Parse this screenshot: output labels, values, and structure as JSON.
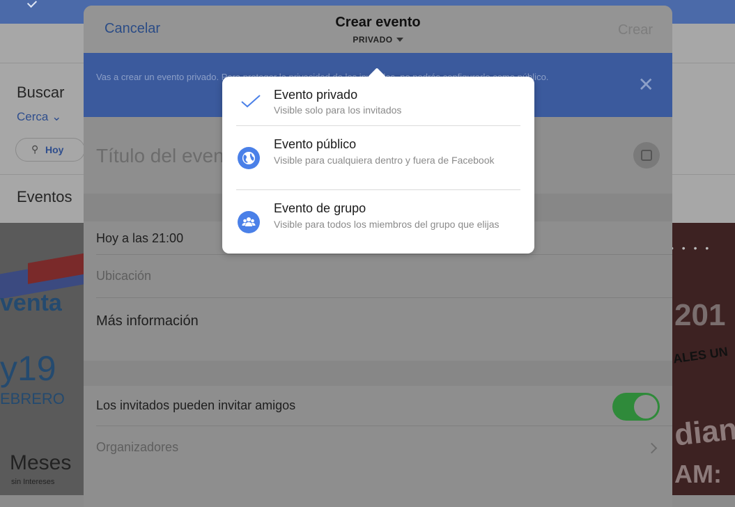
{
  "background": {
    "search_label": "Buscar",
    "nearby_label": "Cerca",
    "today_chip": "Hoy",
    "events_heading": "Eventos",
    "left_poster": {
      "word": "venta",
      "number": "y19",
      "month": "EBRERO",
      "promo": "Meses",
      "promo_sub": "sin Intereses"
    },
    "right_poster": {
      "year": "201",
      "line": "ALES UN",
      "word": "dian",
      "word2": "AM:"
    }
  },
  "nav": {
    "cancel_label": "Cancelar",
    "title": "Crear evento",
    "privacy_label": "PRIVADO",
    "create_label": "Crear"
  },
  "banner": {
    "text": "Vas a crear un evento privado. Para proteger la privacidad de los invitados, no podrás configurarlo como público.",
    "close_glyph": "✕"
  },
  "form": {
    "title_placeholder": "Título del evento",
    "datetime": "Hoy a las 21:00",
    "location_placeholder": "Ubicación",
    "more_info": "Más información",
    "guests_can_invite_label": "Los invitados pueden invitar amigos",
    "guests_can_invite_on": true,
    "organizers_label": "Organizadores"
  },
  "privacy_menu": {
    "options": [
      {
        "title": "Evento privado",
        "description": "Visible solo para los invitados",
        "icon": "checkmark-icon",
        "selected": true
      },
      {
        "title": "Evento público",
        "description": "Visible para cualquiera dentro y fuera de Facebook",
        "icon": "globe-icon",
        "selected": false
      },
      {
        "title": "Evento de grupo",
        "description": "Visible para todos los miembros del grupo que elijas",
        "icon": "group-icon",
        "selected": false
      }
    ]
  },
  "colors": {
    "facebook_blue": "#3b5998",
    "icon_blue": "#4a80e8",
    "toggle_green": "#4cd964"
  }
}
